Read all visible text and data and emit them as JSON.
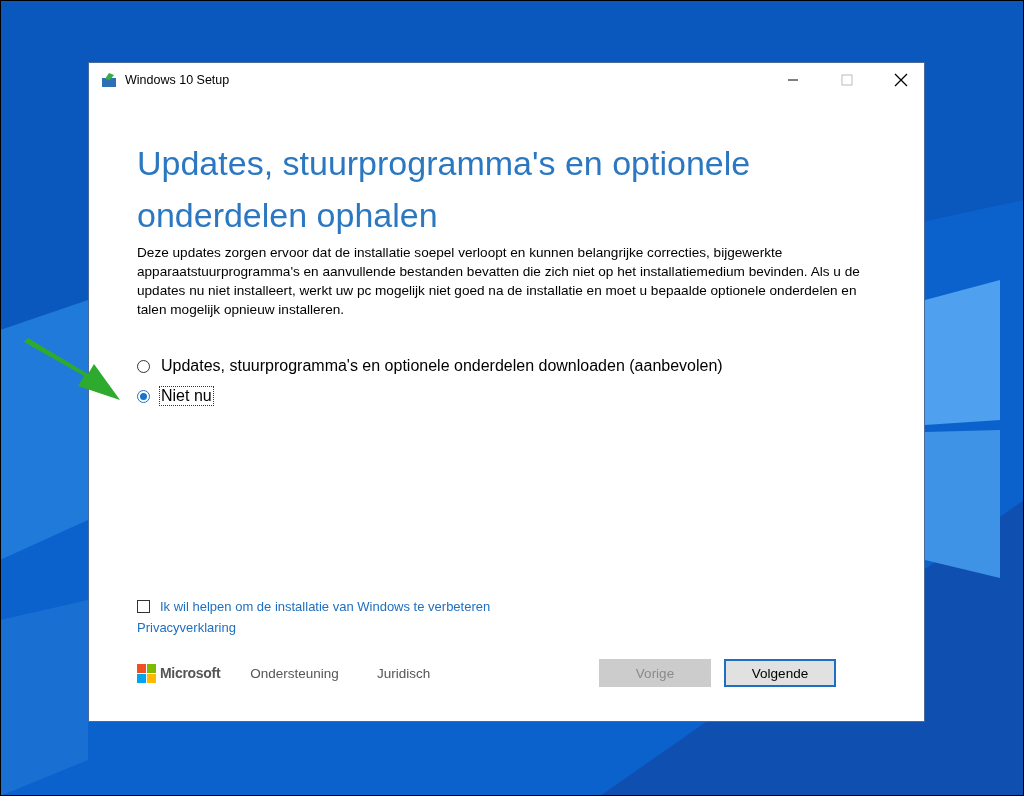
{
  "window": {
    "title": "Windows 10 Setup"
  },
  "heading": "Updates, stuurprogramma's en optionele onderdelen ophalen",
  "description": "Deze updates zorgen ervoor dat de installatie soepel verloopt en kunnen belangrijke correcties, bijgewerkte apparaatstuurprogramma's en aanvullende bestanden bevatten die zich niet op het installatiemedium bevinden. Als u de updates nu niet installeert, werkt uw pc mogelijk niet goed na de installatie en moet u bepaalde optionele onderdelen en talen mogelijk opnieuw installeren.",
  "options": [
    {
      "label": "Updates, stuurprogramma's en optionele onderdelen downloaden (aanbevolen)",
      "selected": false,
      "focused": false
    },
    {
      "label": "Niet nu",
      "selected": true,
      "focused": true
    }
  ],
  "checkbox": {
    "label": "Ik wil helpen om de installatie van Windows te verbeteren",
    "checked": false
  },
  "privacy_link": "Privacyverklaring",
  "footer": {
    "brand": "Microsoft",
    "links": [
      "Ondersteuning",
      "Juridisch"
    ]
  },
  "buttons": [
    {
      "label": "Vorige",
      "disabled": true,
      "default": false
    },
    {
      "label": "Volgende",
      "disabled": false,
      "default": true
    }
  ]
}
